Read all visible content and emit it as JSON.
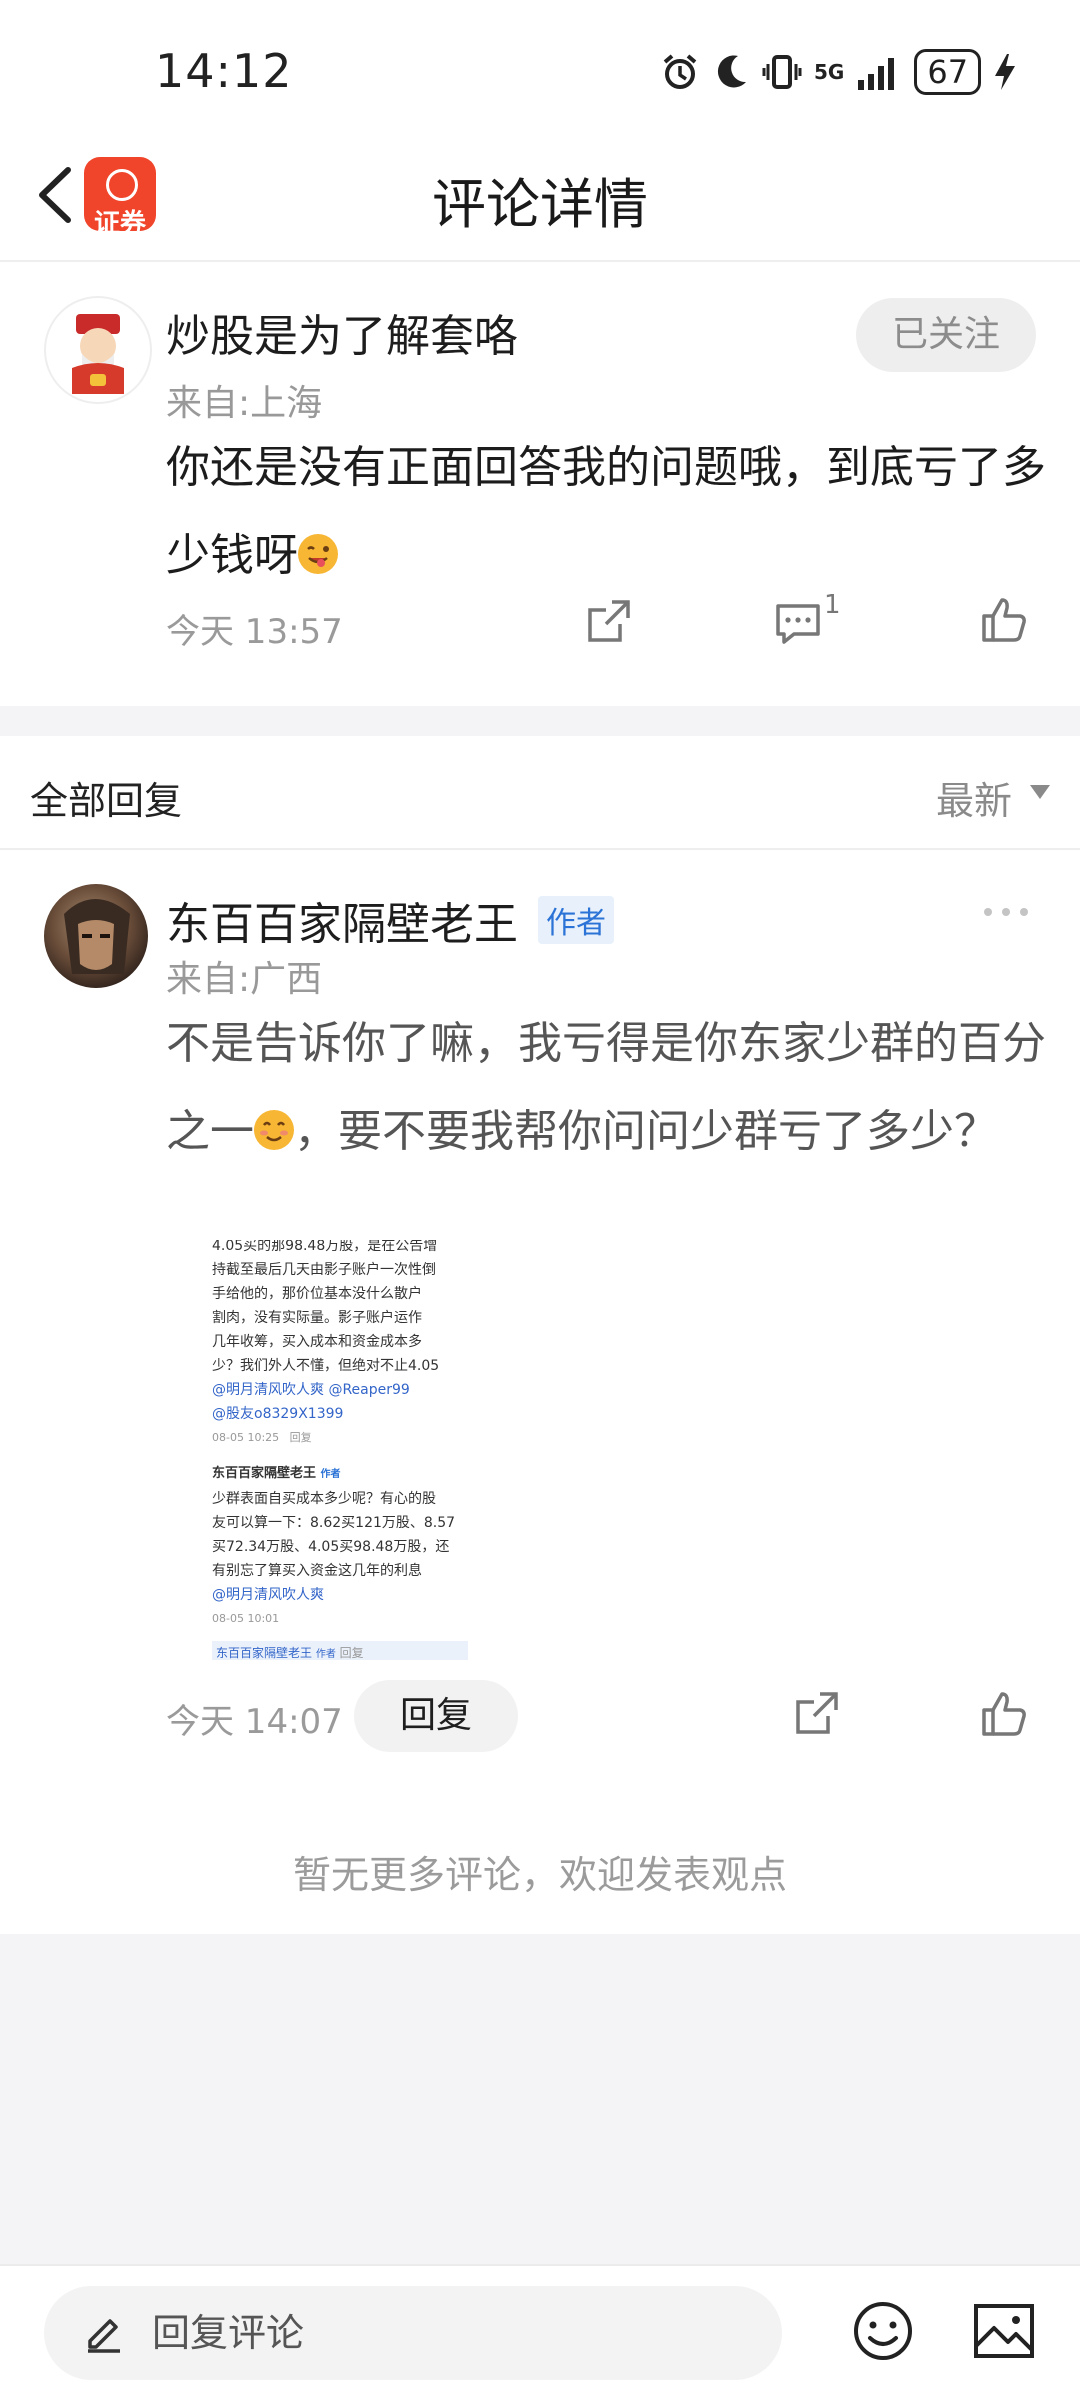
{
  "status_bar": {
    "time": "14:12",
    "network": "5G",
    "battery": "67",
    "icons": [
      "alarm-icon",
      "moon-icon",
      "vibrate-icon",
      "signal-icon",
      "battery-icon",
      "charging-icon"
    ]
  },
  "header": {
    "title": "评论详情",
    "app_logo_text": "证券"
  },
  "main_comment": {
    "username": "炒股是为了解套咯",
    "location": "来自:上海",
    "follow_label": "已关注",
    "text": "你还是没有正面回答我的问题哦，到底亏了多少钱呀",
    "time": "今天 13:57",
    "comment_count": "1"
  },
  "replies_section": {
    "title": "全部回复",
    "sort": "最新"
  },
  "reply": {
    "username": "东百百家隔壁老王",
    "badge": "作者",
    "location": "来自:广西",
    "text": "不是告诉你了嘛，我亏得是你东家少群的百分之一",
    "text_after_emoji": "，要不要我帮你问问少群亏了多少？",
    "time": "今天 14:07",
    "reply_label": "回复",
    "embedded_screenshot": {
      "lines_top": [
        "4.05买的那98.48万股，是在公告增",
        "持截至最后几天由影子账户一次性倒",
        "手给他的，那价位基本没什么散户",
        "割肉，没有实际量。影子账户运作",
        "几年收筹，买入成本和资金成本多",
        "少？我们外人不懂，但绝对不止4.05"
      ],
      "mentions_1": "@明月清风吹人爽 @Reaper99",
      "mentions_2": "@股友o8329X1399",
      "date_1": "08-05 10:25",
      "reply_1": "回复",
      "author": "东百百家隔壁老王",
      "author_badge": "作者",
      "lines_bottom": [
        "少群表面自买成本多少呢？有心的股",
        "友可以算一下：8.62买121万股、8.57",
        "买72.34万股、4.05买98.48万股，还",
        "有别忘了算买入资金这几年的利息"
      ],
      "mention_3": "@明月清风吹人爽",
      "date_2": "08-05 10:01",
      "footer": "东百百家隔壁老王",
      "footer_badge": "作者",
      "footer_reply": "回复"
    }
  },
  "no_more_text": "暂无更多评论，欢迎发表观点",
  "bottom_bar": {
    "input_placeholder": "回复评论"
  }
}
